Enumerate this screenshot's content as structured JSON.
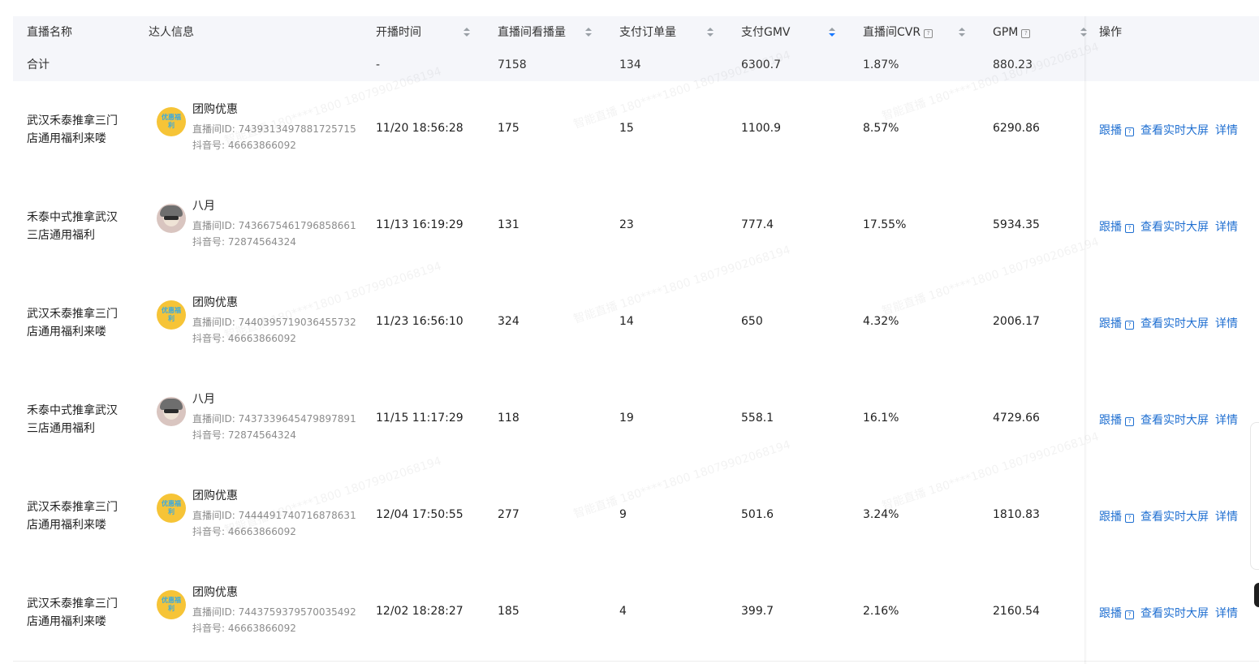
{
  "columns": [
    {
      "key": "name",
      "label": "直播名称"
    },
    {
      "key": "talent",
      "label": "达人信息"
    },
    {
      "key": "start",
      "label": "开播时间"
    },
    {
      "key": "views",
      "label": "直播间看播量"
    },
    {
      "key": "orders",
      "label": "支付订单量"
    },
    {
      "key": "gmv",
      "label": "支付GMV"
    },
    {
      "key": "cvr",
      "label": "直播间CVR"
    },
    {
      "key": "gpm",
      "label": "GPM"
    },
    {
      "key": "ops",
      "label": "操作"
    }
  ],
  "help_glyph": "?",
  "total": {
    "label": "合计",
    "start": "-",
    "views": "7158",
    "orders": "134",
    "gmv": "6300.7",
    "cvr": "1.87%",
    "gpm": "880.23"
  },
  "actions": {
    "follow": "跟播",
    "screen": "查看实时大屏",
    "detail": "详情"
  },
  "rows": [
    {
      "name": "武汉禾泰推拿三门店通用福利来喽",
      "avatar": "yellow-coupon-avatar",
      "avatar_text": "优惠福利",
      "user": "团购优惠",
      "room_id": "直播间ID: 7439313497881725715",
      "douyin": "抖音号: 46663866092",
      "start": "11/20 18:56:28",
      "views": "175",
      "orders": "15",
      "gmv": "1100.9",
      "cvr": "8.57%",
      "gpm": "6290.86"
    },
    {
      "name": "禾泰中式推拿武汉三店通用福利",
      "avatar": "girl-glasses-avatar",
      "avatar_text": "",
      "user": "八月",
      "room_id": "直播间ID: 7436675461796858661",
      "douyin": "抖音号: 72874564324",
      "start": "11/13 16:19:29",
      "views": "131",
      "orders": "23",
      "gmv": "777.4",
      "cvr": "17.55%",
      "gpm": "5934.35"
    },
    {
      "name": "武汉禾泰推拿三门店通用福利来喽",
      "avatar": "yellow-coupon-avatar",
      "avatar_text": "优惠福利",
      "user": "团购优惠",
      "room_id": "直播间ID: 7440395719036455732",
      "douyin": "抖音号: 46663866092",
      "start": "11/23 16:56:10",
      "views": "324",
      "orders": "14",
      "gmv": "650",
      "cvr": "4.32%",
      "gpm": "2006.17"
    },
    {
      "name": "禾泰中式推拿武汉三店通用福利",
      "avatar": "girl-glasses-avatar",
      "avatar_text": "",
      "user": "八月",
      "room_id": "直播间ID: 7437339645479897891",
      "douyin": "抖音号: 72874564324",
      "start": "11/15 11:17:29",
      "views": "118",
      "orders": "19",
      "gmv": "558.1",
      "cvr": "16.1%",
      "gpm": "4729.66"
    },
    {
      "name": "武汉禾泰推拿三门店通用福利来喽",
      "avatar": "yellow-coupon-avatar",
      "avatar_text": "优惠福利",
      "user": "团购优惠",
      "room_id": "直播间ID: 7444491740716878631",
      "douyin": "抖音号: 46663866092",
      "start": "12/04 17:50:55",
      "views": "277",
      "orders": "9",
      "gmv": "501.6",
      "cvr": "3.24%",
      "gpm": "1810.83"
    },
    {
      "name": "武汉禾泰推拿三门店通用福利来喽",
      "avatar": "yellow-coupon-avatar",
      "avatar_text": "优惠福利",
      "user": "团购优惠",
      "room_id": "直播间ID: 7443759379570035492",
      "douyin": "抖音号: 46663866092",
      "start": "12/02 18:28:27",
      "views": "185",
      "orders": "4",
      "gmv": "399.7",
      "cvr": "2.16%",
      "gpm": "2160.54"
    }
  ],
  "watermark": "智能直播 180****1800 18079902068194",
  "colors": {
    "link": "#1f6fd1",
    "header_bg": "#f5f6fa",
    "sort_active": "#1677ff",
    "avatar_yellow": "#f6c437"
  }
}
